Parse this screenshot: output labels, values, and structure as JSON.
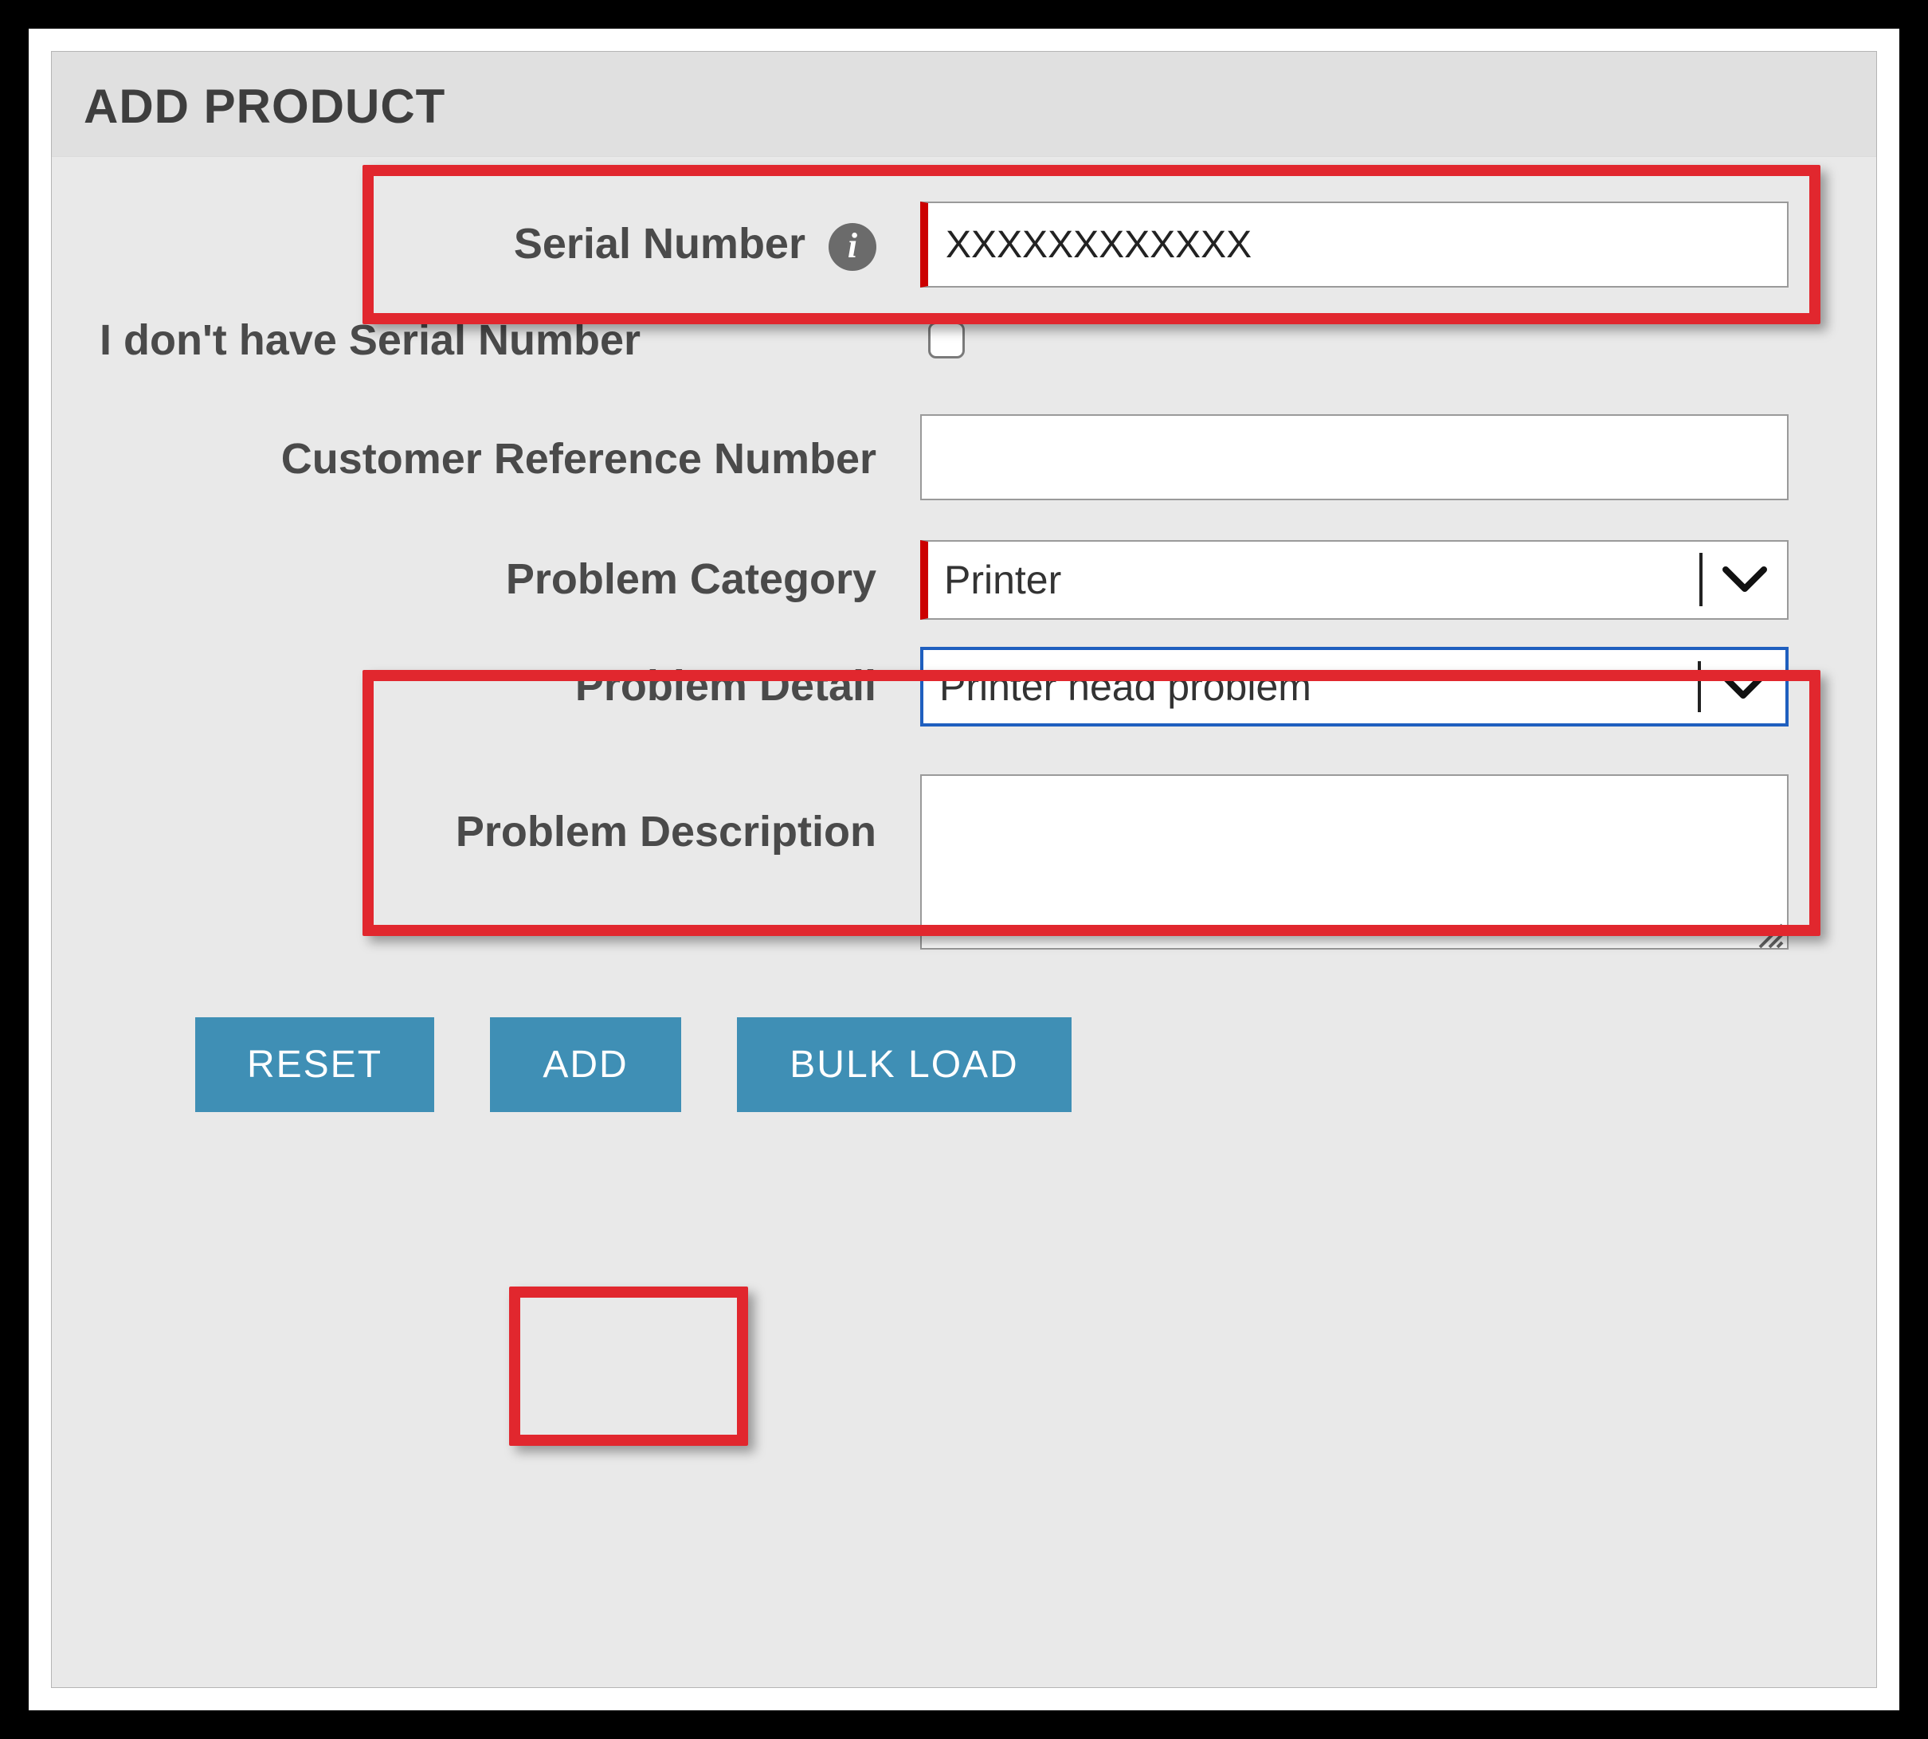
{
  "header": {
    "title": "ADD PRODUCT"
  },
  "fields": {
    "serial": {
      "label": "Serial Number",
      "value": "XXXXXXXXXXXX",
      "info_icon": "info-icon"
    },
    "no_serial": {
      "label": "I don't have Serial Number",
      "checked": false
    },
    "cust_ref": {
      "label": "Customer Reference Number",
      "value": ""
    },
    "problem_category": {
      "label": "Problem Category",
      "value": "Printer"
    },
    "problem_detail": {
      "label": "Problem Detail",
      "value": "Printer head problem"
    },
    "problem_description": {
      "label": "Problem Description",
      "value": ""
    }
  },
  "buttons": {
    "reset": "RESET",
    "add": "ADD",
    "bulk_load": "BULK LOAD"
  },
  "colors": {
    "accent_button": "#3f8fb5",
    "callout_border": "#e1272e",
    "required_marker": "#cc0000",
    "panel_bg": "#e9e9e9"
  }
}
